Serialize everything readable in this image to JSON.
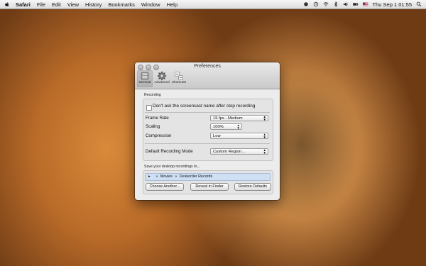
{
  "menubar": {
    "app_name": "Safari",
    "items": [
      "File",
      "Edit",
      "View",
      "History",
      "Bookmarks",
      "Window",
      "Help"
    ],
    "clock": "Thu Sep 1  01:55"
  },
  "window": {
    "title": "Preferences",
    "tabs": [
      {
        "label": "General",
        "icon": "general-icon"
      },
      {
        "label": "Advanced",
        "icon": "gear-icon"
      },
      {
        "label": "Shortcuts",
        "icon": "shortcuts-icon"
      }
    ]
  },
  "recording": {
    "section_label": "Recording",
    "dont_ask_label": "Don't ask the screencast name after stop recording",
    "frame_rate": {
      "label": "Frame Rate",
      "value": "15 fps - Medium"
    },
    "scaling": {
      "label": "Scaling",
      "value": "100%"
    },
    "compression": {
      "label": "Compression",
      "value": "Low"
    },
    "default_mode": {
      "label": "Default Recording Mode",
      "value": "Custom Region..."
    }
  },
  "save": {
    "section_label": "Save your desktop recordings to...",
    "path": [
      "Movies",
      "Deskorder Records"
    ],
    "buttons": {
      "choose": "Choose Another...",
      "reveal": "Reveal in Finder",
      "restore": "Restore Defaults"
    }
  }
}
